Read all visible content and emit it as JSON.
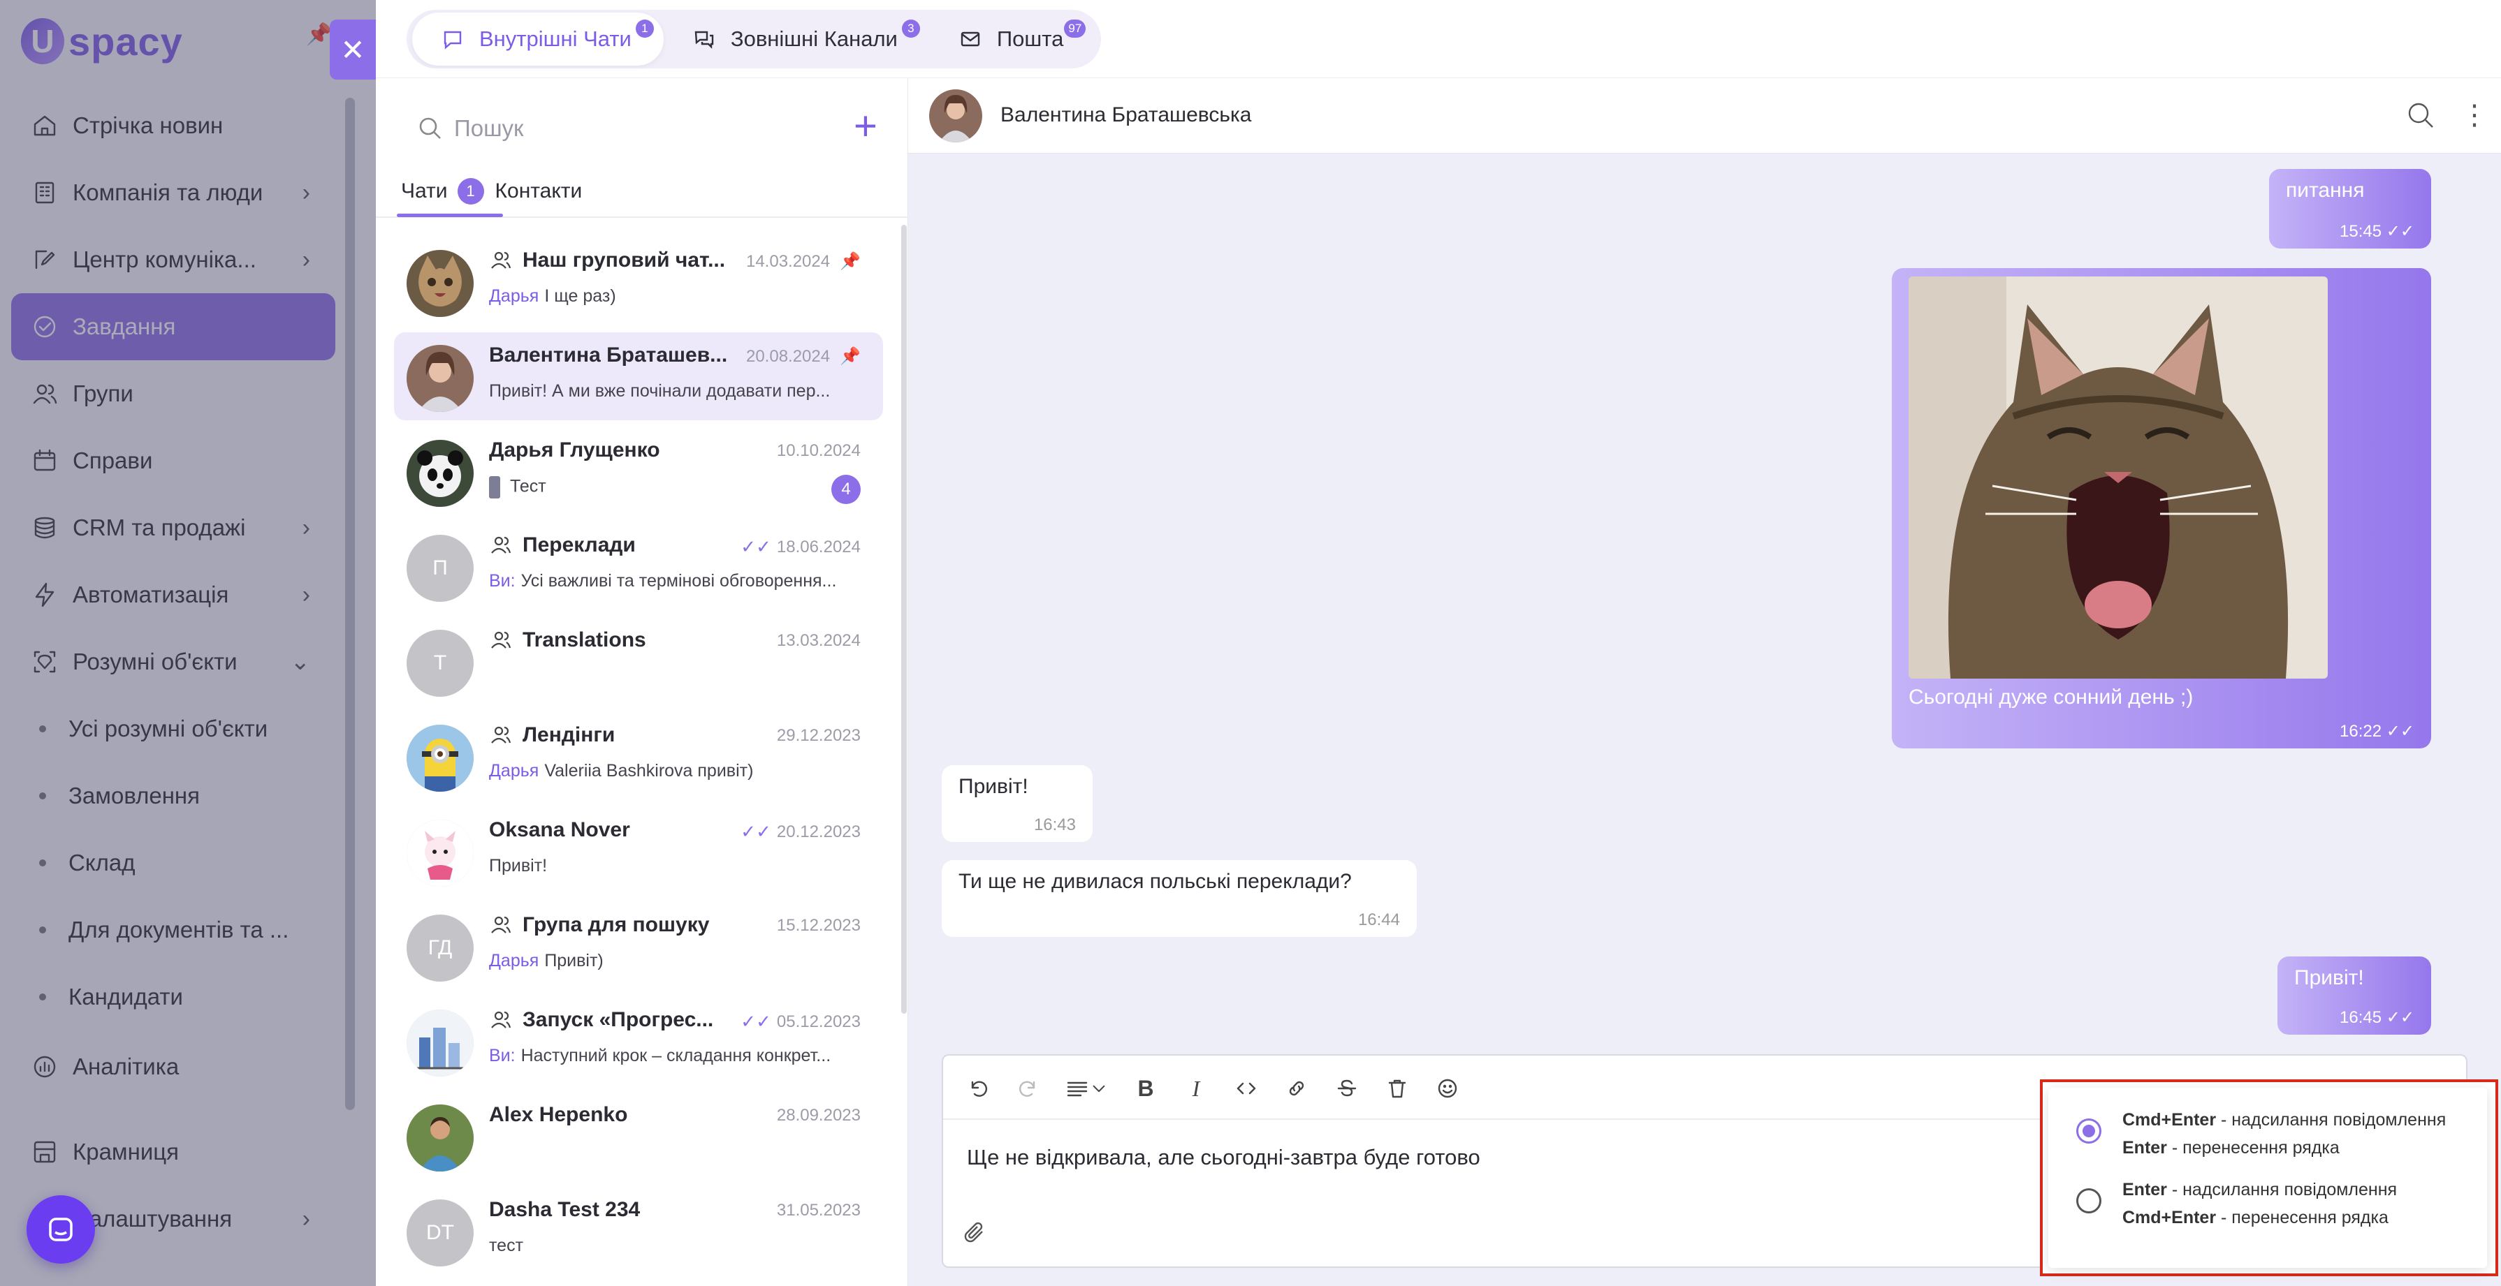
{
  "app": {
    "logo_letter": "U",
    "logo_text": "spacy"
  },
  "sidebar": {
    "items": [
      {
        "label": "Стрічка новин",
        "icon": "home-icon",
        "chevron": false
      },
      {
        "label": "Компанія та люди",
        "icon": "building-icon",
        "chevron": true
      },
      {
        "label": "Центр комуніка...",
        "icon": "edit-icon",
        "chevron": true
      },
      {
        "label": "Завдання",
        "icon": "check-circle-icon",
        "chevron": false,
        "active": true
      },
      {
        "label": "Групи",
        "icon": "users-icon",
        "chevron": false
      },
      {
        "label": "Справи",
        "icon": "calendar-icon",
        "chevron": false
      },
      {
        "label": "CRM та продажі",
        "icon": "database-icon",
        "chevron": true
      },
      {
        "label": "Автоматизація",
        "icon": "lightning-icon",
        "chevron": true
      },
      {
        "label": "Розумні об'єкти",
        "icon": "smart-object-icon",
        "chevron": true,
        "expanded": true
      },
      {
        "label": "Усі розумні об'єкти",
        "sub": true
      },
      {
        "label": "Замовлення",
        "sub": true
      },
      {
        "label": "Склад",
        "sub": true
      },
      {
        "label": "Для документів та ...",
        "sub": true
      },
      {
        "label": "Кандидати",
        "sub": true
      },
      {
        "label": "Аналітика",
        "icon": "analytics-icon",
        "chevron": false
      },
      {
        "label": "Крамниця",
        "icon": "store-icon",
        "chevron": false
      },
      {
        "label": "Налаштування",
        "icon": "settings-icon",
        "chevron": true
      }
    ]
  },
  "tabs": [
    {
      "label": "Внутрішні Чати",
      "badge": "1",
      "icon": "chat-icon",
      "active": true
    },
    {
      "label": "Зовнішні Канали",
      "badge": "3",
      "icon": "channels-icon"
    },
    {
      "label": "Пошта",
      "badge": "97",
      "icon": "mail-icon"
    }
  ],
  "list": {
    "search_placeholder": "Пошук",
    "subtabs": [
      {
        "label": "Чати",
        "badge": "1"
      },
      {
        "label": "Контакти"
      }
    ],
    "chats": [
      {
        "name": "Наш груповий чат...",
        "date": "14.03.2024",
        "group": true,
        "pinned": true,
        "sender": "Дарья",
        "preview": "І ще раз)",
        "avatar": "cat"
      },
      {
        "name": "Валентина Браташев...",
        "date": "20.08.2024",
        "pinned": true,
        "preview": "Привіт! А ми вже почінали додавати пер...",
        "avatar": "woman",
        "selected": true
      },
      {
        "name": "Дарья Глущенко",
        "date": "10.10.2024",
        "preview": "Тест",
        "unread": "4",
        "avatar": "panda",
        "attachment": true
      },
      {
        "name": "Переклади",
        "date": "18.06.2024",
        "group": true,
        "read": true,
        "sender": "Ви:",
        "preview": "Усі важливі та термінові обговорення...",
        "initials": "П"
      },
      {
        "name": "Translations",
        "date": "13.03.2024",
        "group": true,
        "initials": "T"
      },
      {
        "name": "Лендінги",
        "date": "29.12.2023",
        "group": true,
        "sender": "Дарья",
        "preview": "Valeriia Bashkirova привіт)",
        "avatar": "minion"
      },
      {
        "name": "Oksana Nover",
        "date": "20.12.2023",
        "read": true,
        "preview": "Привіт!",
        "avatar": "cartoon"
      },
      {
        "name": "Група для пошуку",
        "date": "15.12.2023",
        "group": true,
        "sender": "Дарья",
        "preview": "Привіт)",
        "initials": "ГД"
      },
      {
        "name": "Запуск «Прогрес...",
        "date": "05.12.2023",
        "group": true,
        "read": true,
        "sender": "Ви:",
        "preview": "Наступний крок – складання конкрет...",
        "avatar": "buildings"
      },
      {
        "name": "Alex Hepenko",
        "date": "28.09.2023",
        "avatar": "man"
      },
      {
        "name": "Dasha Test 234",
        "date": "31.05.2023",
        "preview": "тест",
        "initials": "DT"
      }
    ]
  },
  "conversation": {
    "title": "Валентина Браташевська",
    "messages": [
      {
        "dir": "out",
        "text": "питання",
        "time": "15:45"
      },
      {
        "dir": "out",
        "text": "Сьогодні дуже сонний день ;)",
        "time": "16:22",
        "image": "yawning-cat"
      },
      {
        "dir": "in",
        "text": "Привіт!",
        "time": "16:43"
      },
      {
        "dir": "in",
        "text": "Ти ще не дивилася польські переклади?",
        "time": "16:44"
      },
      {
        "dir": "out",
        "text": "Привіт!",
        "time": "16:45"
      }
    ],
    "composer_text": "Ще не відкривала, але сьогодні-завтра буде готово"
  },
  "send_modes": [
    {
      "k1": "Cmd+Enter",
      "t1": " - надсилання повідомлення",
      "k2": "Enter",
      "t2": " - перенесення рядка",
      "selected": true
    },
    {
      "k1": "Enter",
      "t1": " - надсилання повідомлення",
      "k2": "Cmd+Enter",
      "t2": " - перенесення рядка",
      "selected": false
    }
  ],
  "colors": {
    "accent": "#8c6ee8",
    "highlight_box": "#d72a1b",
    "conversation_bg": "#eeeef9"
  }
}
